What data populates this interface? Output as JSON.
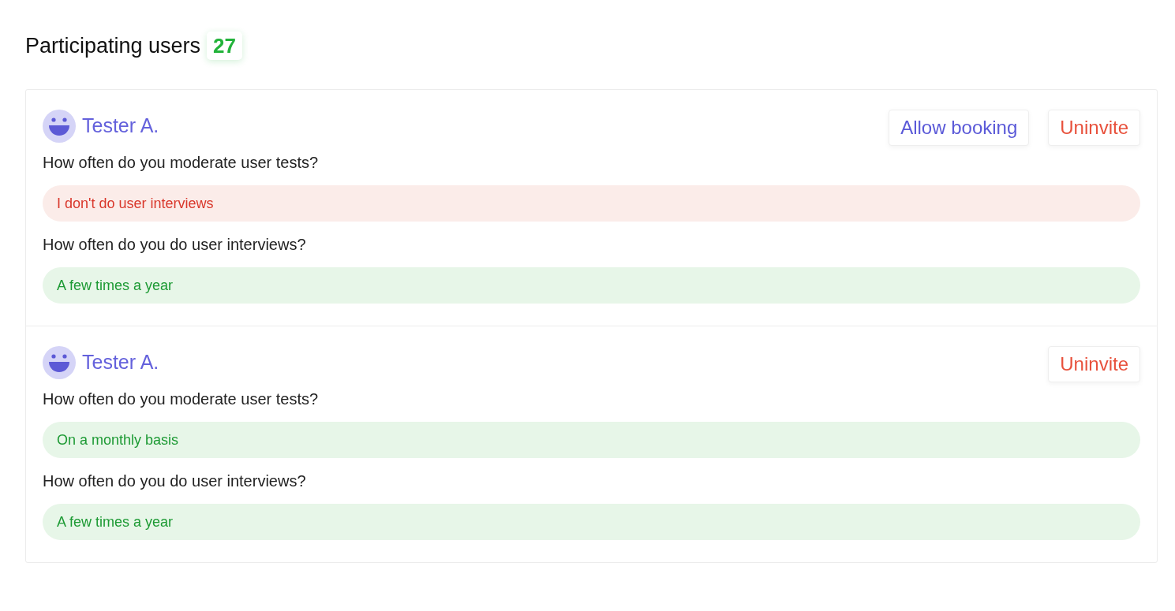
{
  "title": "Participating users",
  "count": "27",
  "users": [
    {
      "name": "Tester A.",
      "buttons": [
        {
          "label": "Allow booking",
          "kind": "primary"
        },
        {
          "label": "Uninvite",
          "kind": "danger"
        }
      ],
      "questions": [
        {
          "question": "How often do you moderate user tests?",
          "answer": "I don't do user interviews",
          "kind": "negative"
        },
        {
          "question": "How often do you do user interviews?",
          "answer": "A few times a year",
          "kind": "positive"
        }
      ]
    },
    {
      "name": "Tester A.",
      "buttons": [
        {
          "label": "Uninvite",
          "kind": "danger"
        }
      ],
      "questions": [
        {
          "question": "How often do you moderate user tests?",
          "answer": "On a monthly basis",
          "kind": "positive"
        },
        {
          "question": "How often do you do user interviews?",
          "answer": "A few times a year",
          "kind": "positive"
        }
      ]
    }
  ]
}
